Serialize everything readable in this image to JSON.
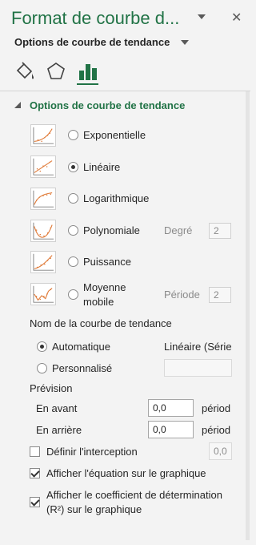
{
  "pane": {
    "title": "Format de courbe d...",
    "subheader": "Options de courbe de tendance"
  },
  "tabs": [
    {
      "icon": "paint-bucket-icon"
    },
    {
      "icon": "pentagon-icon"
    },
    {
      "icon": "bar-chart-icon",
      "selected": true
    }
  ],
  "section": {
    "title": "Options de courbe de tendance"
  },
  "trend_types": [
    {
      "label": "Exponentielle",
      "selected": false
    },
    {
      "label": "Linéaire",
      "selected": true
    },
    {
      "label": "Logarithmique",
      "selected": false
    },
    {
      "label": "Polynomiale",
      "selected": false,
      "param_label": "Degré",
      "param_value": "2"
    },
    {
      "label": "Puissance",
      "selected": false
    },
    {
      "label_line1": "Moyenne",
      "label_line2": "mobile",
      "selected": false,
      "param_label": "Période",
      "param_value": "2"
    }
  ],
  "name_section": {
    "heading": "Nom de la courbe de tendance",
    "auto_label": "Automatique",
    "auto_value": "Linéaire (Série",
    "custom_label": "Personnalisé",
    "custom_value": ""
  },
  "forecast": {
    "heading": "Prévision",
    "forward_label": "En avant",
    "forward_value": "0,0",
    "backward_label": "En arrière",
    "backward_value": "0,0",
    "unit": "périod"
  },
  "intercept": {
    "label": "Définir l'interception",
    "value": "0,0",
    "checked": false
  },
  "show_equation": {
    "label": "Afficher l'équation sur le graphique",
    "checked": true
  },
  "show_r2": {
    "line1": "Afficher le coefficient de détermination",
    "line2": "(R²) sur le graphique",
    "checked": true
  },
  "colors": {
    "accent": "#217346",
    "trend": "#e07b39"
  }
}
